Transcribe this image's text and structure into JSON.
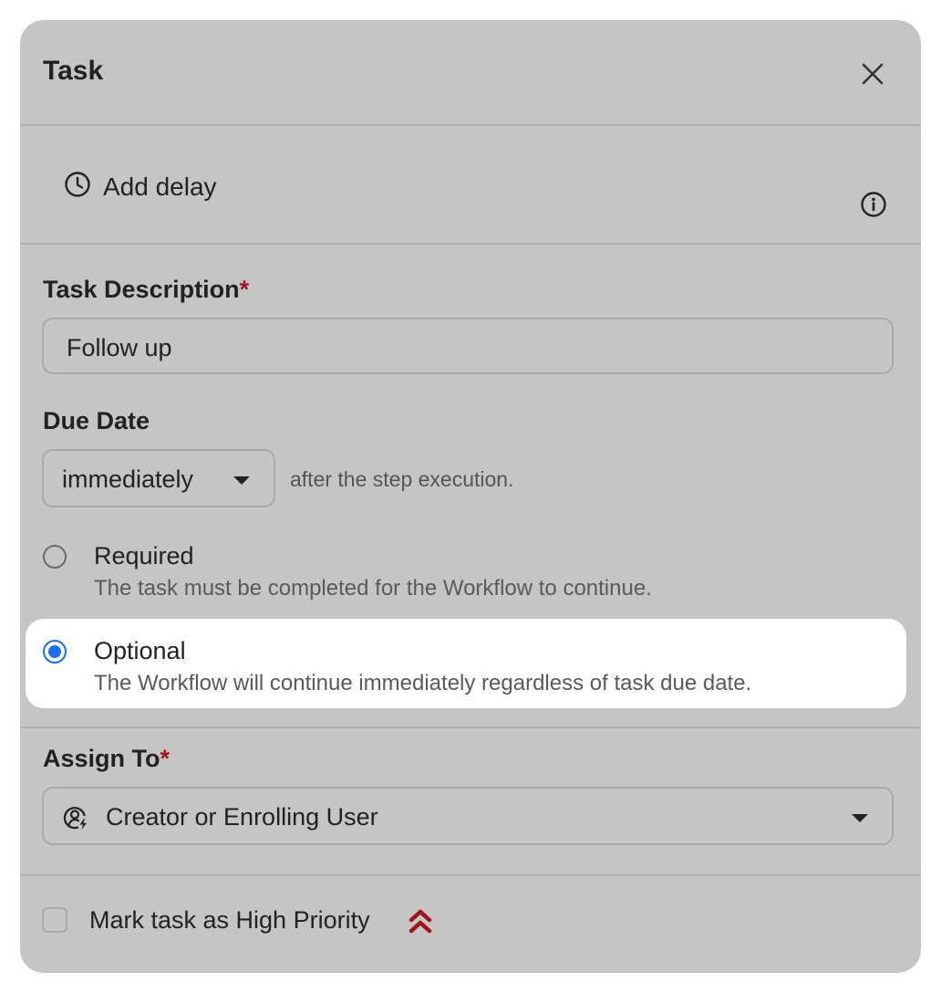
{
  "header": {
    "title": "Task"
  },
  "delay": {
    "label": "Add delay"
  },
  "task_description": {
    "label": "Task Description",
    "required_mark": "*",
    "value": "Follow up"
  },
  "due_date": {
    "label": "Due Date",
    "selected": "immediately",
    "suffix": "after the step execution."
  },
  "completion": {
    "options": [
      {
        "title": "Required",
        "description": "The task must be completed for the Workflow to continue.",
        "selected": false
      },
      {
        "title": "Optional",
        "description": "The Workflow will continue immediately regardless of task due date.",
        "selected": true
      }
    ]
  },
  "assign_to": {
    "label": "Assign To",
    "required_mark": "*",
    "selected": "Creator or Enrolling User"
  },
  "priority": {
    "label": "Mark task as High Priority",
    "checked": false
  },
  "colors": {
    "panel_bg": "#c5c5c5",
    "required_mark": "#a3111b",
    "radio_selected": "#1a6ff0",
    "priority_icon": "#a3111b"
  },
  "icons": {
    "close": "close-icon",
    "delay": "clock-icon",
    "info": "info-icon",
    "caret": "caret-down-icon",
    "assign": "user-bolt-icon",
    "priority": "double-chevron-up-icon"
  }
}
